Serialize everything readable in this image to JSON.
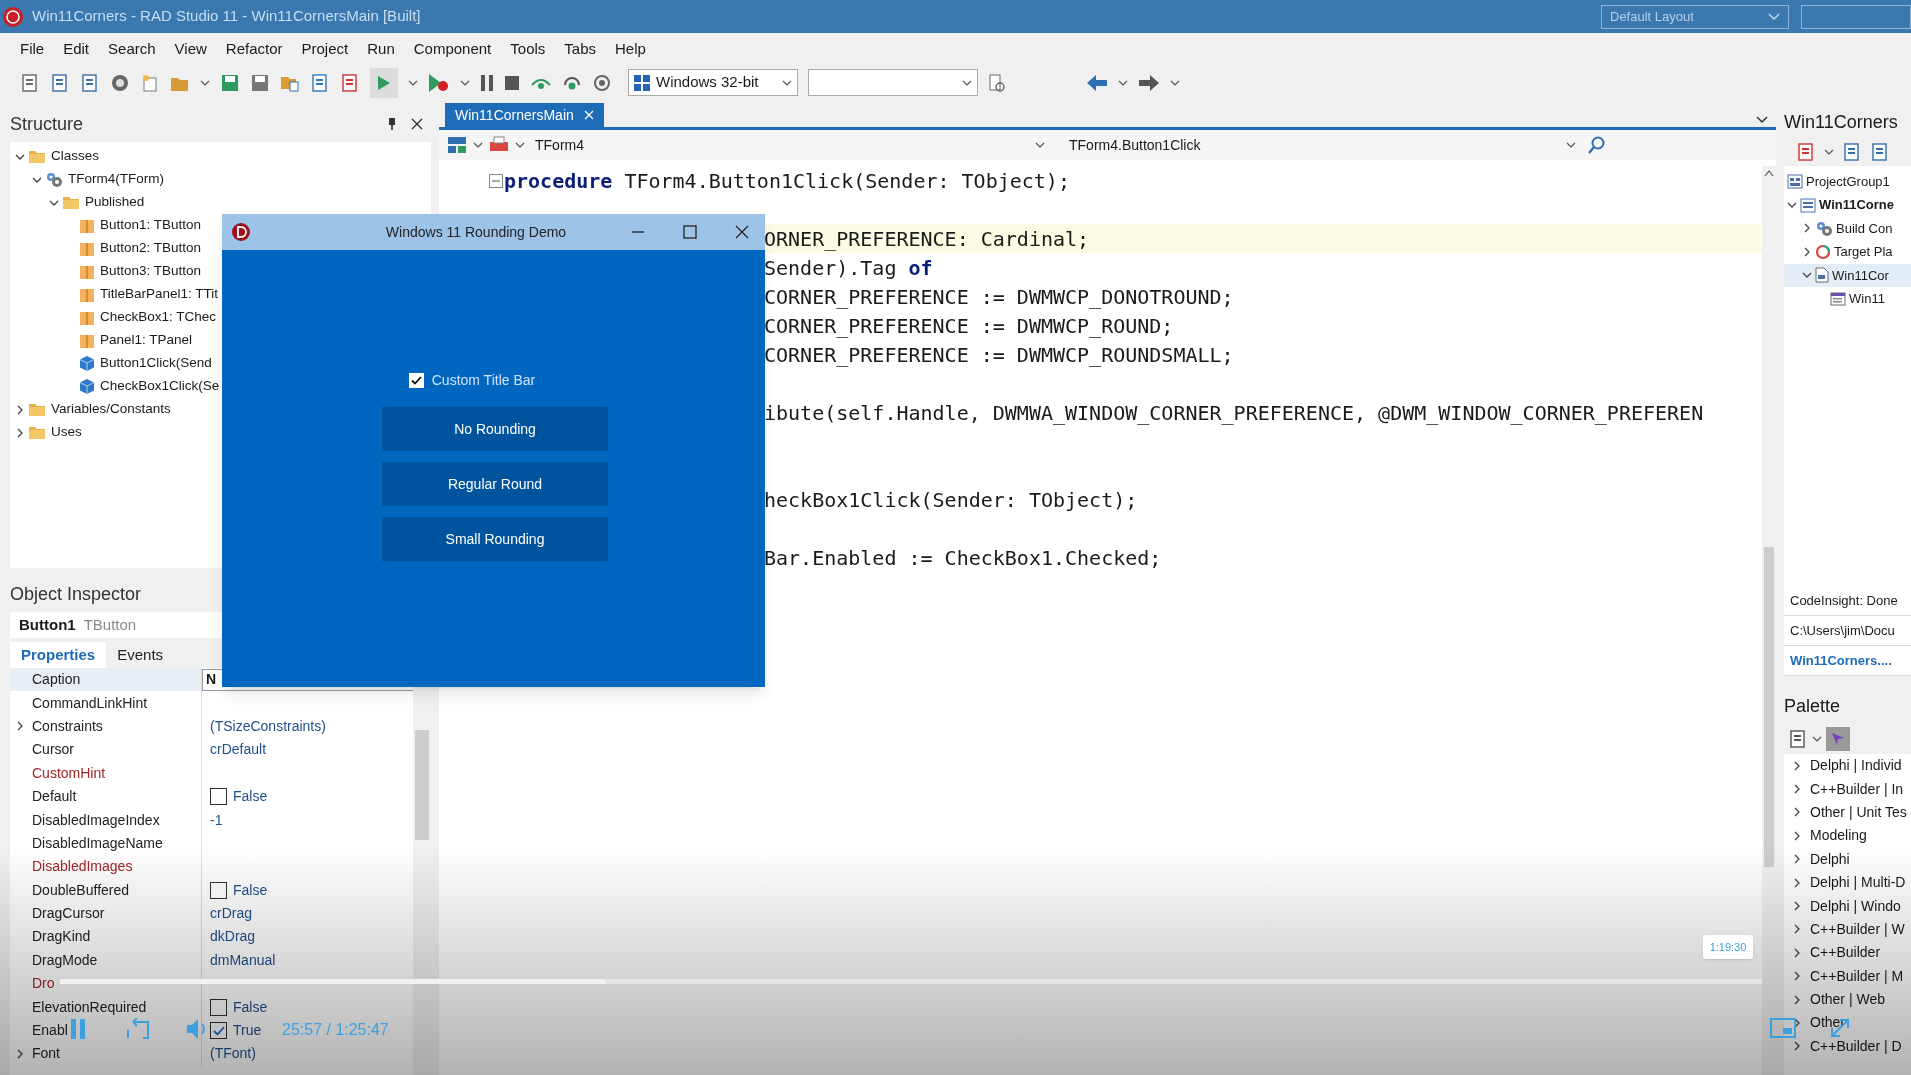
{
  "app_title": "Win11Corners - RAD Studio 11 - Win11CornersMain [Built]",
  "layout_combo": "Default Layout",
  "menu": [
    "File",
    "Edit",
    "Search",
    "View",
    "Refactor",
    "Project",
    "Run",
    "Component",
    "Tools",
    "Tabs",
    "Help"
  ],
  "toolbar": {
    "platform": "Windows 32-bit"
  },
  "structure": {
    "title": "Structure",
    "tree": [
      {
        "label": "Classes",
        "kind": "folder",
        "expanded": true,
        "children": [
          {
            "label": "TForm4(TForm)",
            "kind": "gears",
            "expanded": true,
            "children": [
              {
                "label": "Published",
                "kind": "folder",
                "expanded": true,
                "children": [
                  {
                    "label": "Button1: TButton",
                    "kind": "box"
                  },
                  {
                    "label": "Button2: TButton",
                    "kind": "box"
                  },
                  {
                    "label": "Button3: TButton",
                    "kind": "box"
                  },
                  {
                    "label": "TitleBarPanel1: TTit",
                    "kind": "box"
                  },
                  {
                    "label": "CheckBox1: TChec",
                    "kind": "box"
                  },
                  {
                    "label": "Panel1: TPanel",
                    "kind": "box"
                  },
                  {
                    "label": "Button1Click(Send",
                    "kind": "cube"
                  },
                  {
                    "label": "CheckBox1Click(Se",
                    "kind": "cube"
                  }
                ]
              }
            ]
          }
        ]
      },
      {
        "label": "Variables/Constants",
        "kind": "folder",
        "expanded": false
      },
      {
        "label": "Uses",
        "kind": "folder",
        "expanded": false
      }
    ]
  },
  "object_inspector": {
    "title": "Object Inspector",
    "component_name": "Button1",
    "component_type": "TButton",
    "tabs": [
      {
        "label": "Properties",
        "selected": true
      },
      {
        "label": "Events",
        "selected": false
      }
    ],
    "properties": [
      {
        "name": "Caption",
        "kind": "edit",
        "value": "N"
      },
      {
        "name": "CommandLinkHint",
        "kind": "text"
      },
      {
        "name": "Constraints",
        "kind": "text",
        "value": "(TSizeConstraints)",
        "expandable": true
      },
      {
        "name": "Cursor",
        "kind": "text",
        "value": "crDefault"
      },
      {
        "name": "CustomHint",
        "kind": "text",
        "reference": true
      },
      {
        "name": "Default",
        "kind": "check",
        "value": "False",
        "checked": false
      },
      {
        "name": "DisabledImageIndex",
        "kind": "text",
        "value": "-1"
      },
      {
        "name": "DisabledImageName",
        "kind": "text"
      },
      {
        "name": "DisabledImages",
        "kind": "text",
        "reference": true
      },
      {
        "name": "DoubleBuffered",
        "kind": "check",
        "value": "False",
        "checked": false
      },
      {
        "name": "DragCursor",
        "kind": "text",
        "value": "crDrag"
      },
      {
        "name": "DragKind",
        "kind": "text",
        "value": "dkDrag"
      },
      {
        "name": "DragMode",
        "kind": "text",
        "value": "dmManual"
      },
      {
        "name": "Dro",
        "kind": "text",
        "reference": true
      },
      {
        "name": "ElevationRequired",
        "kind": "check",
        "value": "False",
        "checked": false
      },
      {
        "name": "Enabl",
        "kind": "check",
        "value": "True",
        "checked": true
      },
      {
        "name": "Font",
        "kind": "text",
        "value": "(TFont)",
        "expandable": true
      }
    ]
  },
  "editor": {
    "tab": "Win11CornersMain",
    "class_combo": "TForm4",
    "method_combo": "TForm4.Button1Click",
    "lines": [
      {
        "kind": "full",
        "text": "**procedure** TForm4.Button1Click(Sender: TObject);"
      },
      {
        "kind": "blank"
      },
      {
        "kind": "clipped",
        "text": "ORNER_PREFERENCE: Cardinal;",
        "current": true
      },
      {
        "kind": "clipped",
        "text": "Sender).Tag **of**"
      },
      {
        "kind": "clipped",
        "text": "CORNER_PREFERENCE := DWMWCP_DONOTROUND;"
      },
      {
        "kind": "clipped",
        "text": "CORNER_PREFERENCE := DWMWCP_ROUND;"
      },
      {
        "kind": "clipped",
        "text": "CORNER_PREFERENCE := DWMWCP_ROUNDSMALL;"
      },
      {
        "kind": "blank"
      },
      {
        "kind": "clipped",
        "text": "ibute(self.Handle, DWMWA_WINDOW_CORNER_PREFERENCE, @DWM_WINDOW_CORNER_PREFEREN"
      },
      {
        "kind": "blank"
      },
      {
        "kind": "blank"
      },
      {
        "kind": "clipped",
        "text": "heckBox1Click(Sender: TObject);"
      },
      {
        "kind": "blank"
      },
      {
        "kind": "clipped",
        "text": "Bar.Enabled := CheckBox1.Checked;"
      }
    ]
  },
  "dialog": {
    "title": "Windows 11 Rounding Demo",
    "checkbox": {
      "label": "Custom Title Bar",
      "checked": true
    },
    "buttons": [
      "No Rounding",
      "Regular Round",
      "Small Rounding"
    ]
  },
  "projects": {
    "title": "Win11Corners",
    "tree": [
      {
        "label": "ProjectGroup1",
        "kind": "group",
        "children": [
          {
            "label": "Win11Corne",
            "kind": "project",
            "bold": true,
            "expanded": true,
            "children": [
              {
                "label": "Build Con",
                "kind": "gears",
                "expanded": false
              },
              {
                "label": "Target Pla",
                "kind": "target",
                "expanded": false
              },
              {
                "label": "Win11Cor",
                "kind": "file",
                "expanded": true,
                "selected": true,
                "children": [
                  {
                    "label": "Win11",
                    "kind": "form"
                  }
                ]
              }
            ]
          }
        ]
      }
    ],
    "status": [
      "CodeInsight: Done",
      "C:\\Users\\jim\\Docu",
      "Win11Corners...."
    ]
  },
  "palette": {
    "title": "Palette",
    "items": [
      "Delphi | Individ",
      "C++Builder | In",
      "Other | Unit Tes",
      "Modeling",
      "Delphi",
      "Delphi | Multi-D",
      "Delphi | Windo",
      "C++Builder | W",
      "C++Builder",
      "C++Builder | M",
      "Other | Web",
      "Other",
      "C++Builder | D"
    ]
  },
  "video_player": {
    "progress": {
      "level": 0.32
    },
    "time": "25:57 / 1:25:47",
    "tooltip": "1:19:30"
  }
}
